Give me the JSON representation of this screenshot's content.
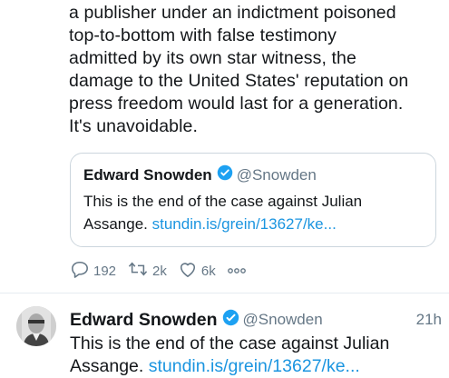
{
  "tweet": {
    "text_lines": [
      "a publisher under an indictment poisoned",
      "top-to-bottom with false testimony",
      "admitted by its own star witness, the",
      "damage to the United States' reputation on",
      "press freedom would last for a generation.",
      "It's unavoidable."
    ],
    "quote": {
      "name": "Edward Snowden",
      "handle": "@Snowden",
      "text_line1": "This is the end of the case against Julian",
      "text_line2_prefix": "Assange. ",
      "link": "stundin.is/grein/13627/ke..."
    },
    "actions": {
      "replies": "192",
      "retweets": "2k",
      "likes": "6k"
    }
  },
  "next_tweet": {
    "name": "Edward Snowden",
    "handle": "@Snowden",
    "time": "21h",
    "text_line1": "This is the end of the case against Julian",
    "text_line2_prefix": "Assange. ",
    "link": "stundin.is/grein/13627/ke..."
  },
  "colors": {
    "text": "#14171a",
    "secondary": "#657786",
    "link": "#1b95e0",
    "border": "#ccd6dd",
    "verified": "#1da1f2"
  },
  "icons": [
    "verified-badge-icon",
    "reply-icon",
    "retweet-icon",
    "like-icon",
    "more-icon"
  ]
}
